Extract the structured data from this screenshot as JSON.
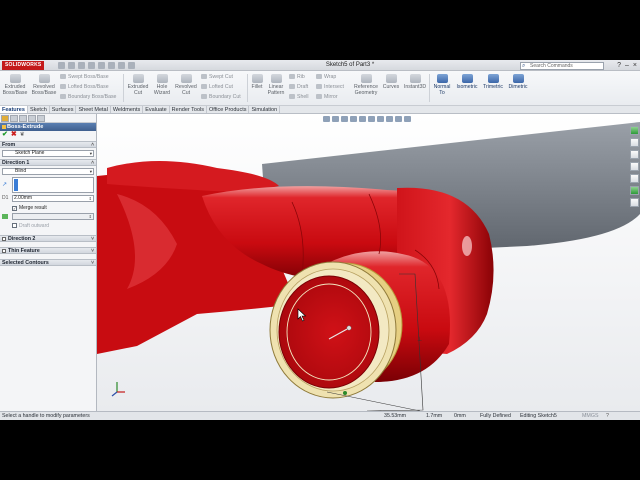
{
  "app": {
    "logo": "SOLIDWORKS",
    "doc_title": "Sketch5 of Part3 *",
    "search_placeholder": "Search Commands"
  },
  "ribbon": {
    "extruded_boss": "Extruded\nBoss/Base",
    "revolved_boss": "Revolved\nBoss/Base",
    "swept_boss": "Swept Boss/Base",
    "lofted_boss": "Lofted Boss/Base",
    "boundary_boss": "Boundary Boss/Base",
    "extruded_cut": "Extruded\nCut",
    "hole_wizard": "Hole\nWizard",
    "revolved_cut": "Revolved\nCut",
    "swept_cut": "Swept Cut",
    "lofted_cut": "Lofted Cut",
    "boundary_cut": "Boundary Cut",
    "fillet": "Fillet",
    "linear_pattern": "Linear\nPattern",
    "rib": "Rib",
    "draft": "Draft",
    "shell": "Shell",
    "wrap": "Wrap",
    "intersect": "Intersect",
    "mirror": "Mirror",
    "reference_geometry": "Reference\nGeometry",
    "curves": "Curves",
    "instant3d": "Instant3D",
    "normal_to": "Normal\nTo",
    "isometric": "Isometric",
    "trimetric": "Trimetric",
    "dimetric": "Dimetric"
  },
  "tabs": [
    "Features",
    "Sketch",
    "Surfaces",
    "Sheet Metal",
    "Weldments",
    "Evaluate",
    "Render Tools",
    "Office Products",
    "Simulation"
  ],
  "property_manager": {
    "title": "Boss-Extrude",
    "from_label": "From",
    "from_value": "Sketch Plane",
    "direction1_label": "Direction 1",
    "end_condition": "Blind",
    "depth": "2.00mm",
    "merge_result": "Merge result",
    "draft_outward": "Draft outward",
    "direction2_label": "Direction 2",
    "thin_feature_label": "Thin Feature",
    "selected_contours_label": "Selected Contours"
  },
  "status": {
    "message": "Select a handle to modify parameters",
    "x": "35.53mm",
    "y": "1.7mm",
    "z": "0mm",
    "state": "Fully Defined",
    "editing": "Editing Sketch5",
    "units": "MMGS"
  },
  "colors": {
    "part_red": "#d40d12",
    "preview_yellow": "#e9d98f",
    "ribbon_blue": "#3b66a8",
    "header_blue": "#4a6fa1"
  }
}
